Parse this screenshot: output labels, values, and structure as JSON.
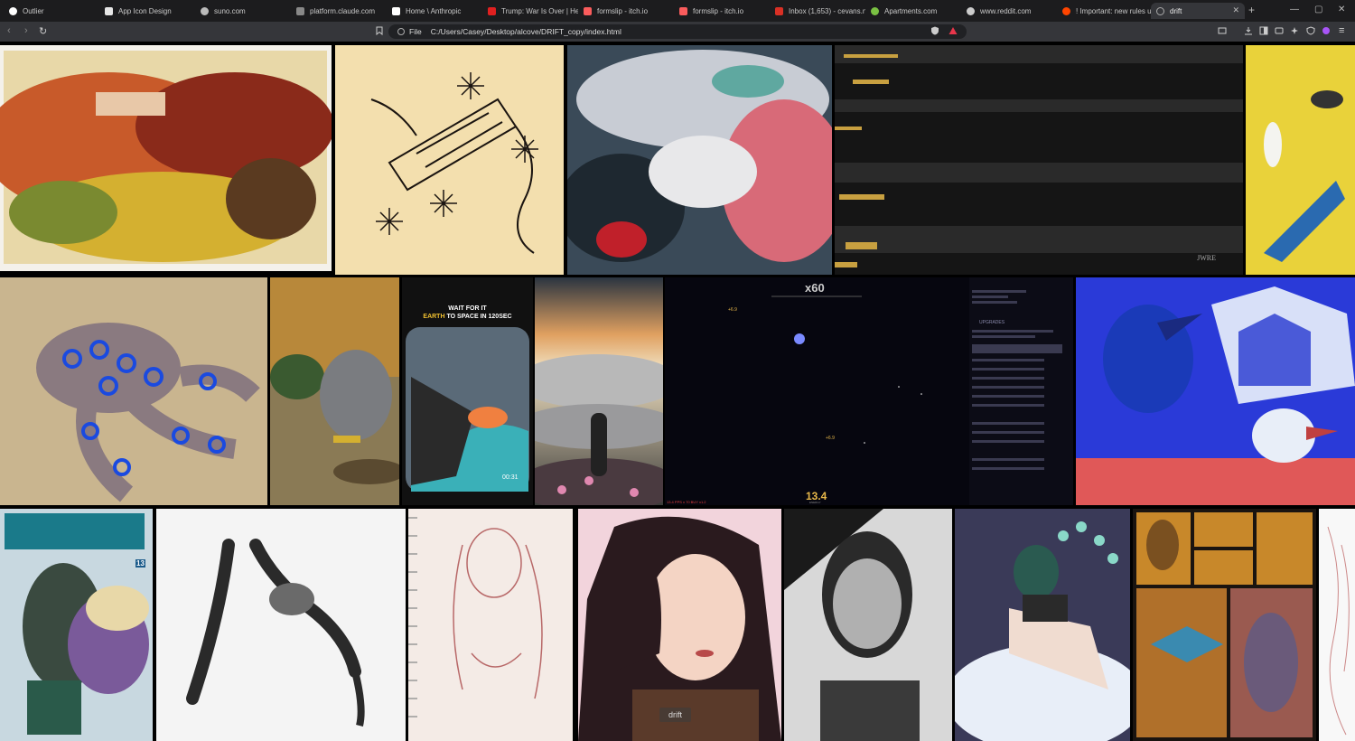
{
  "tabs": [
    {
      "label": "Outlier",
      "color": "#ffffff"
    },
    {
      "label": "App Icon Design",
      "color": "#e6e6e6"
    },
    {
      "label": "suno.com",
      "color": "#bbbbbb"
    },
    {
      "label": "platform.claude.com",
      "color": "#888888"
    },
    {
      "label": "Home \\ Anthropic",
      "color": "#ffffff"
    },
    {
      "label": "Trump: War Is Over | He…",
      "color": "#e02020"
    },
    {
      "label": "formslip - itch.io",
      "color": "#fa5c5c"
    },
    {
      "label": "formslip - itch.io",
      "color": "#fa5c5c"
    },
    {
      "label": "Inbox (1,653) - cevans.n…",
      "color": "#d93025"
    },
    {
      "label": "Apartments.com",
      "color": "#7ac143"
    },
    {
      "label": "www.reddit.com",
      "color": "#cccccc"
    },
    {
      "label": "! Important: new rules u…",
      "color": "#ff4500"
    },
    {
      "label": "drift",
      "color": "#aaaaaa"
    }
  ],
  "address_bar": {
    "scheme_label": "File",
    "url": "C:/Users/Casey/Desktop/alcove/DRIFT_copy/index.html"
  },
  "gallery": {
    "poster_text": {
      "line1": "WAIT FOR IT",
      "line2": "EARTH",
      "line3": "TO SPACE IN 120SEC",
      "timer": "00:31"
    },
    "game": {
      "multiplier": "x60",
      "score": "13.4",
      "score_caption": "ENERGY",
      "float_label_a": "+6.9",
      "float_label_b": "+6.9",
      "upgrades_heading": "UPGRADES",
      "bottom_stats": "13.4 PPS x 70 BUY x1.2"
    },
    "glitch_signature": "JWRE",
    "manga_volume": "13",
    "watermark": "drift"
  },
  "colors": {
    "tabstrip_bg": "#1c1c1e",
    "toolbar_bg": "#35363a",
    "address_bg": "#202124",
    "game_accent": "#e8b84a"
  }
}
